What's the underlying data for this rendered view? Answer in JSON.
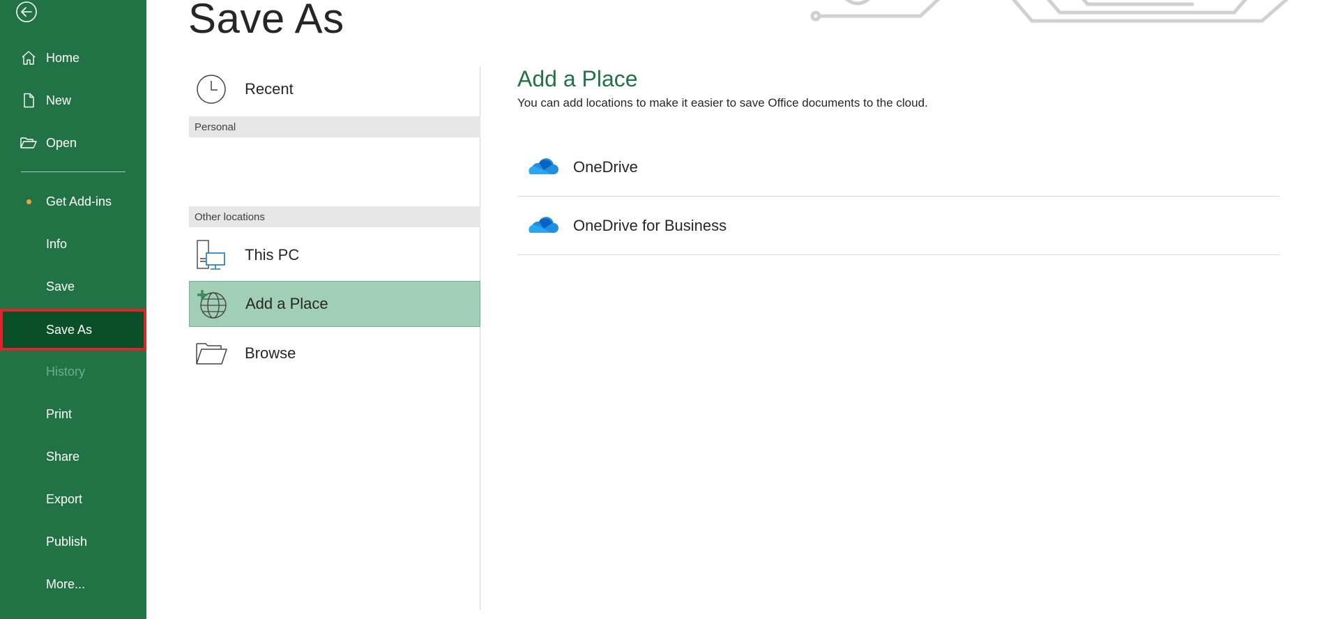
{
  "nav": {
    "back_icon": "back-arrow-icon",
    "items": [
      {
        "id": "home",
        "label": "Home",
        "icon": "home-icon"
      },
      {
        "id": "new",
        "label": "New",
        "icon": "new-document-icon"
      },
      {
        "id": "open",
        "label": "Open",
        "icon": "open-folder-icon"
      },
      {
        "id": "get-add-ins",
        "label": "Get Add-ins"
      },
      {
        "id": "info",
        "label": "Info"
      },
      {
        "id": "save",
        "label": "Save"
      },
      {
        "id": "save-as",
        "label": "Save As",
        "selected": true
      },
      {
        "id": "history",
        "label": "History",
        "disabled": true
      },
      {
        "id": "print",
        "label": "Print"
      },
      {
        "id": "share",
        "label": "Share"
      },
      {
        "id": "export",
        "label": "Export"
      },
      {
        "id": "publish",
        "label": "Publish"
      },
      {
        "id": "more",
        "label": "More..."
      }
    ]
  },
  "page": {
    "title": "Save As"
  },
  "places": {
    "recent": {
      "label": "Recent",
      "icon": "clock-icon"
    },
    "personal_header": "Personal",
    "other_header": "Other locations",
    "this_pc": {
      "label": "This PC",
      "icon": "computer-icon"
    },
    "add_place": {
      "label": "Add a Place",
      "icon": "globe-plus-icon",
      "selected": true
    },
    "browse": {
      "label": "Browse",
      "icon": "folder-icon"
    }
  },
  "detail": {
    "title": "Add a Place",
    "description": "You can add locations to make it easier to save Office documents to the cloud.",
    "services": [
      {
        "label": "OneDrive",
        "icon": "onedrive-cloud-icon"
      },
      {
        "label": "OneDrive for Business",
        "icon": "onedrive-cloud-icon"
      }
    ]
  },
  "colors": {
    "nav_bg": "#217346",
    "nav_selected": "#0a4f28",
    "highlight_outline": "#e0242b",
    "accent": "#217346",
    "place_selected": "#a0cfb5",
    "addins_dot": "#f2a338",
    "onedrive_blue": "#1f8fe0"
  }
}
